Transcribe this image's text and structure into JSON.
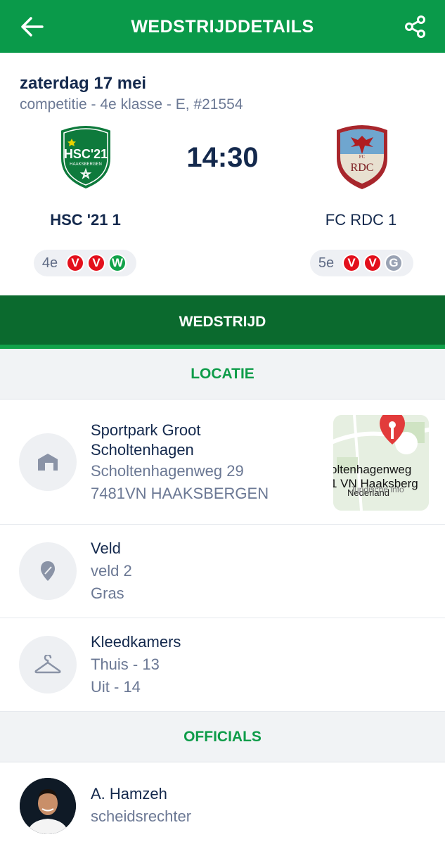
{
  "topbar": {
    "title": "WEDSTRIJDDETAILS",
    "back_icon": "arrow-left-icon",
    "share_icon": "share-icon"
  },
  "match": {
    "date": "zaterdag 17 mei",
    "competition": "competitie - 4e klasse - E, #21554",
    "kickoff": "14:30",
    "home": {
      "name": "HSC '21 1",
      "logo_text": "HSC'21",
      "logo_sub": "HAAKSBERGEN",
      "rank": "4e",
      "form": [
        "V",
        "V",
        "W"
      ]
    },
    "away": {
      "name": "FC RDC 1",
      "logo_text": "RDC",
      "logo_top": "FC",
      "rank": "5e",
      "form": [
        "V",
        "V",
        "G"
      ]
    }
  },
  "tabs": {
    "active": "WEDSTRIJD"
  },
  "location": {
    "section_title": "LOCATIE",
    "venue_line1": "Sportpark Groot",
    "venue_line2": "Scholtenhagen",
    "street": "Scholtenhagenweg 29",
    "postal": "7481VN HAAKSBERGEN",
    "map_line1": "oltenhagenweg",
    "map_line2": "1 VN Haaksberg",
    "map_line3": "Nederland",
    "map_line4": "Juridische info"
  },
  "field": {
    "title": "Veld",
    "number": "veld 2",
    "surface": "Gras"
  },
  "dressing": {
    "title": "Kleedkamers",
    "home": "Thuis - 13",
    "away": "Uit - 14"
  },
  "officials": {
    "section_title": "OFFICIALS",
    "name": "A. Hamzeh",
    "role": "scheidsrechter"
  },
  "colors": {
    "brand_green": "#0a9a4a",
    "tab_green": "#0b6a2e",
    "loss_red": "#e3101c",
    "win_green": "#12a24a",
    "draw_gray": "#9aa3b4",
    "navy": "#14294d"
  }
}
